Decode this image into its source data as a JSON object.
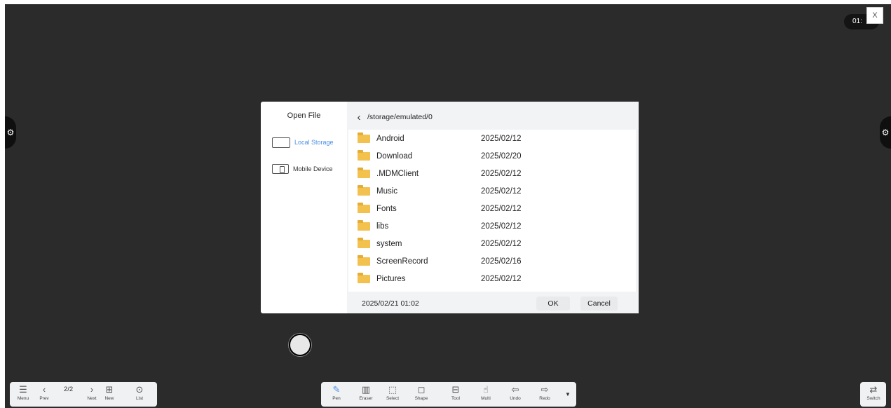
{
  "board": {
    "timer": "01:",
    "close_label": "X",
    "left_tab_icon": "gear-icon",
    "right_tab_icon": "gear-icon"
  },
  "dialog": {
    "title": "Open File",
    "storage": [
      {
        "label": "Local Storage",
        "icon": "tablet-icon",
        "active": true
      },
      {
        "label": "Mobile Device",
        "icon": "phone-icon",
        "active": false
      }
    ],
    "path": "/storage/emulated/0",
    "files": [
      {
        "name": "Android",
        "date": "2025/02/12"
      },
      {
        "name": "Download",
        "date": "2025/02/20"
      },
      {
        "name": ".MDMClient",
        "date": "2025/02/12"
      },
      {
        "name": "Music",
        "date": "2025/02/12"
      },
      {
        "name": "Fonts",
        "date": "2025/02/12"
      },
      {
        "name": "libs",
        "date": "2025/02/12"
      },
      {
        "name": "system",
        "date": "2025/02/12"
      },
      {
        "name": "ScreenRecord",
        "date": "2025/02/16"
      },
      {
        "name": "Pictures",
        "date": "2025/02/12"
      }
    ],
    "footer_date": "2025/02/21 01:02",
    "ok_label": "OK",
    "cancel_label": "Cancel"
  },
  "left_toolbar": {
    "menu": "Menu",
    "prev": "Prev",
    "page": "2/2",
    "next": "Next",
    "new": "New",
    "list": "List"
  },
  "main_toolbar": [
    {
      "label": "Pen",
      "icon": "pen-icon",
      "active": true
    },
    {
      "label": "Eraser",
      "icon": "eraser-icon",
      "active": false
    },
    {
      "label": "Select",
      "icon": "select-icon",
      "active": false
    },
    {
      "label": "Shape",
      "icon": "shape-icon",
      "active": false
    },
    {
      "label": "Tool",
      "icon": "toolbox-icon",
      "active": false
    },
    {
      "label": "Multi",
      "icon": "hand-icon",
      "active": false
    },
    {
      "label": "Undo",
      "icon": "undo-icon",
      "active": false
    },
    {
      "label": "Redo",
      "icon": "redo-icon",
      "active": false
    }
  ],
  "right_toolbar": {
    "switch": "Switch"
  },
  "colors": {
    "board": "#2b2b2b",
    "accent": "#4a90e2",
    "folder": "#f2c14e"
  }
}
